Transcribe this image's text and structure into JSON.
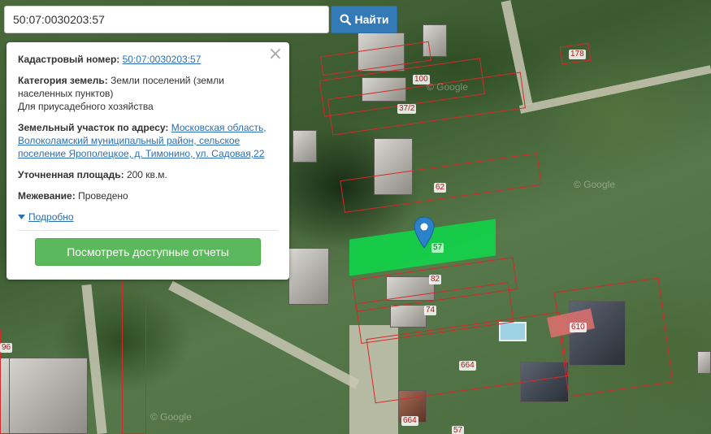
{
  "search": {
    "query": "50:07:0030203:57",
    "button_label": "Найти",
    "button_icon": "search-icon"
  },
  "info": {
    "cadastral_label": "Кадастровый номер:",
    "cadastral_value": "50:07:0030203:57",
    "category_label": "Категория земель:",
    "category_value": "Земли поселений (земли населенных пунктов)",
    "category_use": "Для приусадебного хозяйства",
    "address_label": "Земельный участок по адресу:",
    "address_value": "Московская область, Волоколамский муниципальный район, сельское поселение Ярополецкое, д. Тимонино, ул. Садовая,22",
    "area_label": "Уточненная площадь:",
    "area_value": "200 кв.м.",
    "survey_label": "Межевание:",
    "survey_value": "Проведено",
    "details_label": "Подробно",
    "reports_button": "Посмотреть доступные отчеты",
    "close_symbol": "×"
  },
  "map": {
    "plot_labels": [
      "100",
      "37/2",
      "62",
      "57",
      "82",
      "74",
      "610",
      "664",
      "664",
      "178",
      "96",
      "57"
    ],
    "watermarks": [
      "© Google",
      "© Google",
      "© Google"
    ],
    "colors": {
      "plot_border": "#d42a2a",
      "selected_plot": "#12d34a",
      "highlight": "#e07070",
      "marker": "#2b82cb"
    }
  }
}
